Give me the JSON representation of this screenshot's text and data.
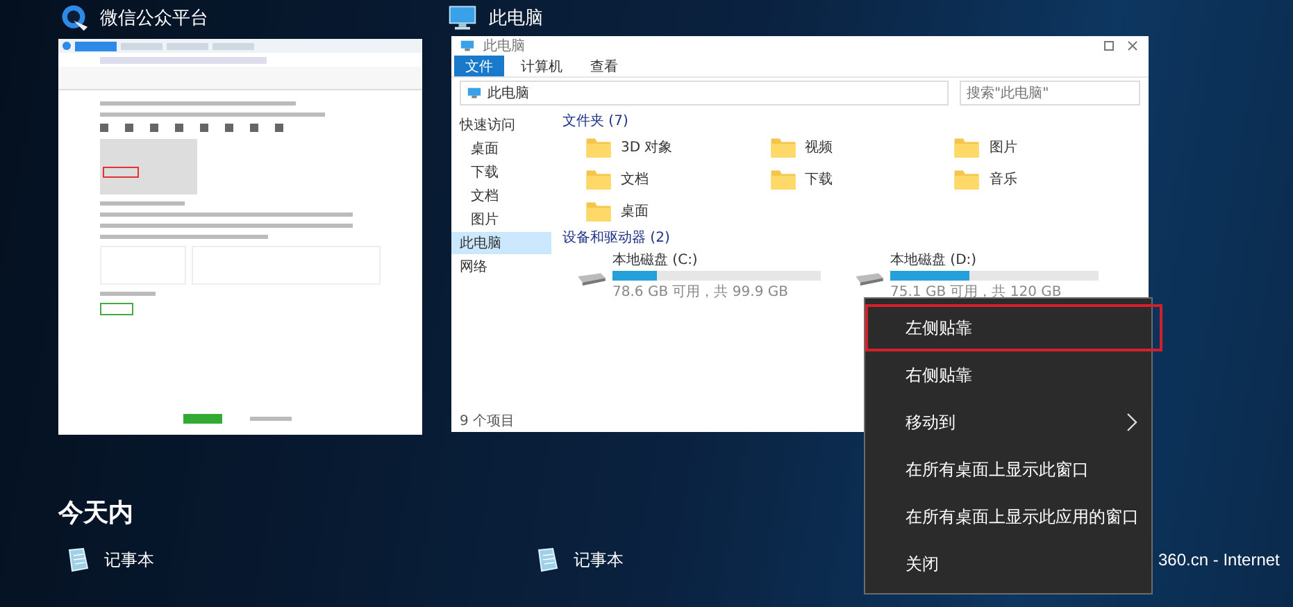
{
  "windows": [
    {
      "kind": "browser",
      "title": "微信公众平台"
    },
    {
      "kind": "explorer",
      "title": "此电脑",
      "explorer": {
        "window_title": "此电脑",
        "ribbon_tabs": [
          {
            "label": "文件",
            "selected": true
          },
          {
            "label": "计算机",
            "selected": false
          },
          {
            "label": "查看",
            "selected": false
          }
        ],
        "address": "此电脑",
        "search": {
          "placeholder": "搜索\"此电脑\""
        },
        "nav": [
          {
            "label": "快速访问",
            "selected": false,
            "children": [
              {
                "label": "桌面",
                "selected": false
              },
              {
                "label": "下载",
                "selected": false
              },
              {
                "label": "文档",
                "selected": false
              },
              {
                "label": "图片",
                "selected": false
              }
            ]
          },
          {
            "label": "此电脑",
            "selected": true
          },
          {
            "label": "网络",
            "selected": false
          }
        ],
        "folders_heading": "文件夹 (7)",
        "folders": [
          {
            "label": "3D 对象"
          },
          {
            "label": "视频"
          },
          {
            "label": "图片"
          },
          {
            "label": "文档"
          },
          {
            "label": "下载"
          },
          {
            "label": "音乐"
          },
          {
            "label": "桌面"
          }
        ],
        "drives_heading": "设备和驱动器 (2)",
        "drives": [
          {
            "label": "本地磁盘 (C:)",
            "level": 0.21,
            "detail": "78.6 GB 可用，共 99.9 GB"
          },
          {
            "label": "本地磁盘 (D:)",
            "level": 0.38,
            "detail": "75.1 GB 可用，共 120 GB"
          }
        ],
        "status": "9 个项目"
      }
    }
  ],
  "context_menu": {
    "items": [
      {
        "label": "左侧贴靠",
        "selected": true,
        "submenu": false
      },
      {
        "label": "右侧贴靠",
        "selected": false,
        "submenu": false
      },
      {
        "label": "移动到",
        "selected": false,
        "submenu": true
      },
      {
        "label": "在所有桌面上显示此窗口",
        "selected": false,
        "submenu": false
      },
      {
        "label": "在所有桌面上显示此应用的窗口",
        "selected": false,
        "submenu": false
      },
      {
        "label": "关闭",
        "selected": false,
        "submenu": false
      }
    ]
  },
  "timeline": {
    "heading": "今天内",
    "items": [
      {
        "kind": "notepad",
        "label": "记事本"
      },
      {
        "kind": "notepad",
        "label": "记事本"
      },
      {
        "kind": "none",
        "label": "360.cn - Internet"
      }
    ]
  }
}
